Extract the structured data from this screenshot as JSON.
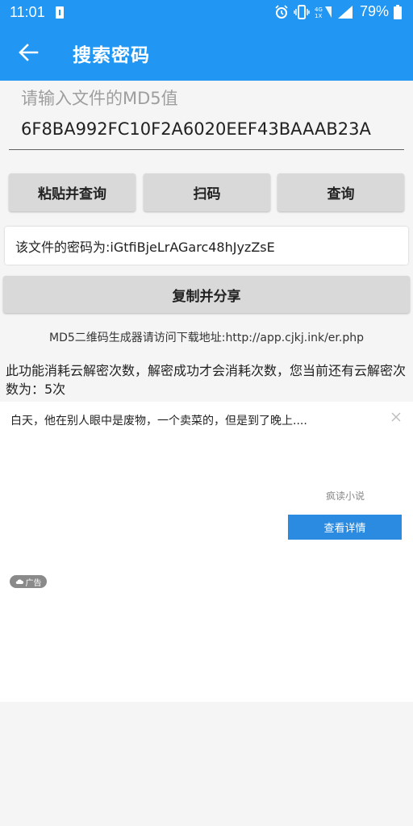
{
  "status_bar": {
    "time": "11:01",
    "battery_percent": "79%",
    "icons": [
      "battery-charging-icon",
      "alarm-icon",
      "vibrate-icon",
      "data-4g-icon",
      "signal-icon",
      "battery-icon"
    ]
  },
  "app_bar": {
    "title": "搜索密码",
    "back_icon": "arrow-left-icon"
  },
  "md5_input": {
    "placeholder": "请输入文件的MD5值",
    "value": "6F8BA992FC10F2A6020EEF43BAAAB23A"
  },
  "actions": {
    "paste_query": "粘贴并查询",
    "scan": "扫码",
    "query": "查询"
  },
  "result": {
    "text": "该文件的密码为:iGtfiBjeLrAGarc48hJyzZsE"
  },
  "copy_share_label": "复制并分享",
  "qr_tool_text": "MD5二维码生成器请访问下载地址:http://app.cjkj.ink/er.php",
  "notice_text": "此功能消耗云解密次数，解密成功才会消耗次数，您当前还有云解密次数为：5次",
  "ad": {
    "headline": "白天，他在别人眼中是废物，一个卖菜的，但是到了晚上....",
    "source": "疯读小说",
    "detail_button": "查看详情",
    "badge": "广告"
  },
  "colors": {
    "primary": "#2196f3",
    "button_bg": "#d9d9d9",
    "ad_button": "#2a8be0"
  }
}
